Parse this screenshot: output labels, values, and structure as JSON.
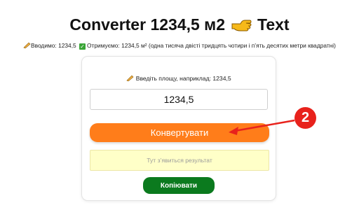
{
  "header": {
    "title_prefix": "Converter 1234,5 м2",
    "title_suffix": "Text",
    "input_label": "Вводимо: 1234,5",
    "output_label": "Отримуємо: 1234,5 м² (одна тисяча двісті тридцять чотири і п’ять десятих метри квадратні)"
  },
  "card": {
    "hint": "Введіть площу, наприклад: 1234,5",
    "input_value": "1234,5",
    "convert_label": "Конвертувати",
    "result_placeholder": "Тут з’явиться результат",
    "copy_label": "Копіювати"
  },
  "annotation": {
    "step_number": "2"
  },
  "colors": {
    "convert_button": "#ff7d1a",
    "copy_button": "#0b7a1e",
    "result_background": "#ffffc8",
    "annotation_red": "#e8221c"
  },
  "icons": {
    "title_icon": "pointing-hand-icon",
    "pencil": "writing-hand-icon",
    "check": "check-mark-icon"
  }
}
